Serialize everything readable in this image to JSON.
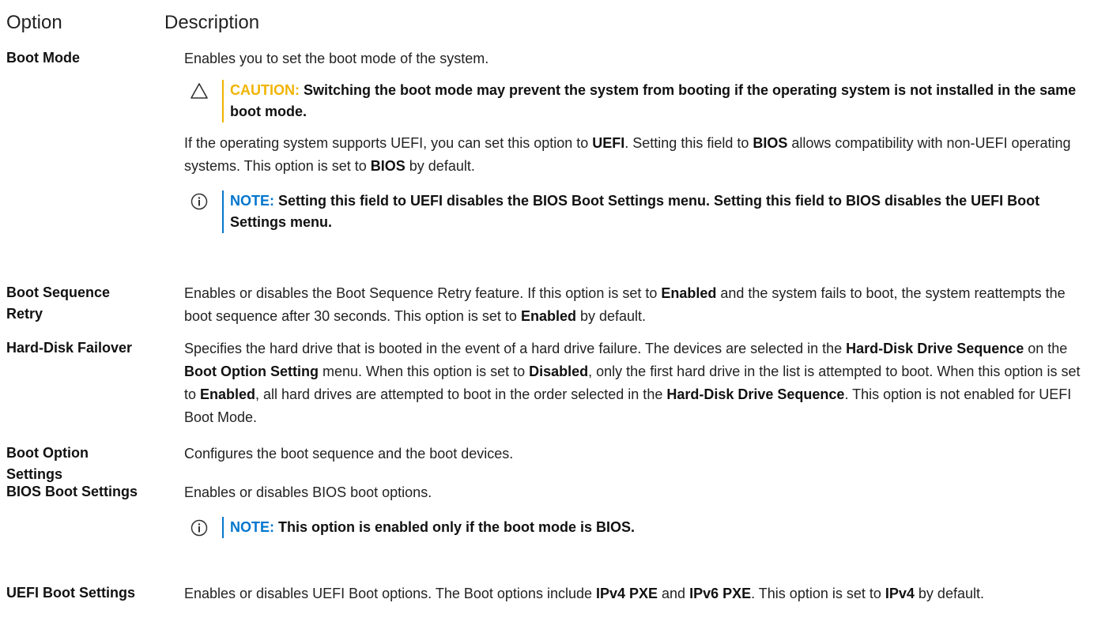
{
  "header": {
    "option": "Option",
    "description": "Description"
  },
  "rows": {
    "boot_mode": {
      "name": "Boot Mode",
      "desc": "Enables you to set the boot mode of the system.",
      "caution": {
        "label": "CAUTION:",
        "text": " Switching the boot mode may prevent the system from booting if the operating system is not installed in the same boot mode."
      },
      "para": {
        "t1": "If the operating system supports UEFI, you can set this option to ",
        "b1": "UEFI",
        "t2": ". Setting this field to ",
        "b2": "BIOS",
        "t3": " allows compatibility with non-UEFI operating systems. This option is set to ",
        "b3": "BIOS",
        "t4": " by default."
      },
      "note": {
        "label": "NOTE:",
        "text": " Setting this field to UEFI disables the BIOS Boot Settings menu. Setting this field to BIOS disables the UEFI Boot Settings menu."
      }
    },
    "boot_sequence_retry": {
      "name": "Boot Sequence Retry",
      "t1": "Enables or disables the Boot Sequence Retry feature. If this option is set to ",
      "b1": "Enabled",
      "t2": " and the system fails to boot, the system reattempts the boot sequence after 30 seconds. This option is set to ",
      "b2": "Enabled",
      "t3": " by default."
    },
    "hard_disk_failover": {
      "name": "Hard-Disk Failover",
      "t1": "Specifies the hard drive that is booted in the event of a hard drive failure. The devices are selected in the ",
      "b1": "Hard-Disk Drive Sequence",
      "t2": " on the ",
      "b2": "Boot Option Setting",
      "t3": " menu. When this option is set to ",
      "b3": "Disabled",
      "t4": ", only the first hard drive in the list is attempted to boot. When this option is set to ",
      "b4": "Enabled",
      "t5": ", all hard drives are attempted to boot in the order selected in the ",
      "b5": "Hard-Disk Drive Sequence",
      "t6": ". This option is not enabled for UEFI Boot Mode."
    },
    "boot_option_settings": {
      "name": "Boot Option Settings",
      "desc": "Configures the boot sequence and the boot devices."
    },
    "bios_boot_settings": {
      "name": "BIOS Boot Settings",
      "desc": "Enables or disables BIOS boot options.",
      "note": {
        "label": "NOTE:",
        "text": " This option is enabled only if the boot mode is BIOS."
      }
    },
    "uefi_boot_settings": {
      "name": "UEFI Boot Settings",
      "t1": "Enables or disables UEFI Boot options. The Boot options include ",
      "b1": "IPv4 PXE",
      "t2": " and ",
      "b2": "IPv6 PXE",
      "t3": ". This option is set to ",
      "b3": "IPv4",
      "t4": " by default."
    }
  },
  "colors": {
    "caution": "#f0b400",
    "note": "#0076ce",
    "text": "#222222"
  },
  "icons": {
    "caution": "caution-triangle-icon",
    "note": "info-circle-icon"
  }
}
